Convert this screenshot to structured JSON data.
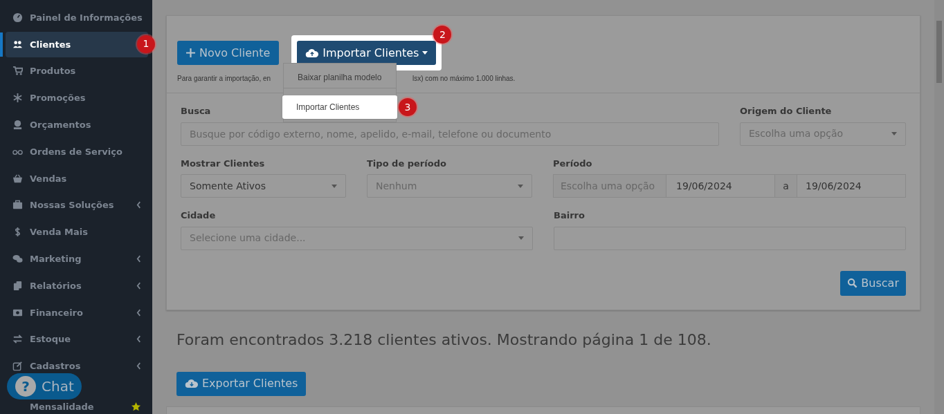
{
  "sidebar": {
    "items": [
      {
        "label": "Painel de Informações",
        "has_submenu": false,
        "selected": false
      },
      {
        "label": "Clientes",
        "has_submenu": false,
        "selected": true,
        "badge": "1"
      },
      {
        "label": "Produtos",
        "has_submenu": false,
        "selected": false
      },
      {
        "label": "Promoções",
        "has_submenu": false,
        "selected": false
      },
      {
        "label": "Orçamentos",
        "has_submenu": false,
        "selected": false
      },
      {
        "label": "Ordens de Serviço",
        "has_submenu": false,
        "selected": false
      },
      {
        "label": "Vendas",
        "has_submenu": false,
        "selected": false
      },
      {
        "label": "Nossas Soluções",
        "has_submenu": true,
        "selected": false
      },
      {
        "label": "Venda Mais",
        "has_submenu": false,
        "selected": false
      },
      {
        "label": "Marketing",
        "has_submenu": true,
        "selected": false
      },
      {
        "label": "Relatórios",
        "has_submenu": true,
        "selected": false
      },
      {
        "label": "Financeiro",
        "has_submenu": true,
        "selected": false
      },
      {
        "label": "Estoque",
        "has_submenu": true,
        "selected": false
      },
      {
        "label": "Cadastros",
        "has_submenu": true,
        "selected": false
      },
      {
        "label": "Mensalidade",
        "has_submenu": false,
        "selected": false,
        "starred": true
      }
    ]
  },
  "chat_button": {
    "label": "Chat",
    "glyph": "?"
  },
  "toolbar": {
    "new_button": "Novo Cliente",
    "import_button": {
      "label": "Importar Clientes",
      "badge": "2"
    },
    "hint_start": "Para garantir a importação, en",
    "hint_end": "lsx) com no máximo 1.000 linhas.",
    "import_menu": [
      {
        "label": "Baixar planilha modelo",
        "selected": false
      },
      {
        "label": "Importar Clientes",
        "selected": true,
        "badge": "3"
      }
    ]
  },
  "filters": {
    "search": {
      "label": "Busca",
      "placeholder": "Busque por código externo, nome, apelido, e-mail, telefone ou documento"
    },
    "origin": {
      "label": "Origem do Cliente",
      "placeholder": "Escolha uma opção"
    },
    "show": {
      "label": "Mostrar Clientes",
      "value": "Somente Ativos"
    },
    "period_type": {
      "label": "Tipo de período",
      "placeholder": "Nenhum"
    },
    "period": {
      "label": "Período",
      "placeholder": "Escolha uma opção",
      "from": "19/06/2024",
      "separator": "a",
      "to": "19/06/2024"
    },
    "city": {
      "label": "Cidade",
      "placeholder": "Selecione uma cidade..."
    },
    "district": {
      "label": "Bairro"
    },
    "search_button": "Buscar"
  },
  "results_text": "Foram encontrados 3.218 clientes ativos. Mostrando página 1 de 108.",
  "export_button": "Exportar Clientes"
}
